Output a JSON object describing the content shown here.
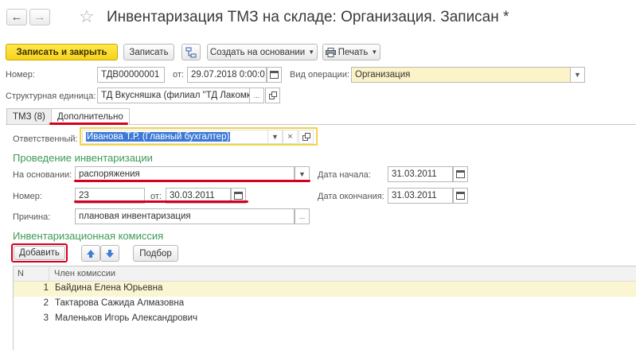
{
  "window": {
    "title": "Инвентаризация ТМЗ на складе: Организация. Записан *"
  },
  "toolbar": {
    "save_close_label": "Записать и закрыть",
    "save_label": "Записать",
    "create_based_label": "Создать на основании",
    "print_label": "Печать"
  },
  "header": {
    "number_label": "Номер:",
    "number_value": "ТДВ00000001",
    "from_label": "от:",
    "date_value": "29.07.2018  0:00:0",
    "operation_label": "Вид операции:",
    "operation_value": "Организация",
    "unit_label": "Структурная единица:",
    "unit_value": "ТД Вкусняшка (филиал \"ТД Лакомк"
  },
  "tabs": [
    {
      "label": "ТМЗ (8)"
    },
    {
      "label": "Дополнительно"
    }
  ],
  "details": {
    "responsible_label": "Ответственный:",
    "responsible_value": "Иванова Т.Р. (Главный бухгалтер)",
    "section_conduct": "Проведение инвентаризации",
    "basis_label": "На основании:",
    "basis_value": "распоряжения",
    "start_label": "Дата начала:",
    "start_value": "31.03.2011",
    "num_label": "Номер:",
    "num_value": "23",
    "from_label": "от:",
    "from_value": "30.03.2011",
    "end_label": "Дата окончания:",
    "end_value": "31.03.2011",
    "reason_label": "Причина:",
    "reason_value": "плановая инвентаризация",
    "section_commission": "Инвентаризационная комиссия",
    "add_label": "Добавить",
    "pick_label": "Подбор"
  },
  "table": {
    "columns": [
      "N",
      "Член комиссии"
    ],
    "rows": [
      {
        "n": "1",
        "member": "Байдина Елена Юрьевна"
      },
      {
        "n": "2",
        "member": "Тактарова Сажида Алмазовна"
      },
      {
        "n": "3",
        "member": "Маленьков Игорь Александрович"
      }
    ]
  },
  "colors": {
    "primary_button": "#f7d21b",
    "section_text": "#3d9a56",
    "highlight_red": "#d6001c",
    "selected_row": "#fbf6d2"
  },
  "icons": [
    "back-arrow-icon",
    "forward-arrow-icon",
    "star-icon",
    "structure-icon",
    "printer-icon",
    "calendar-icon",
    "open-icon",
    "arrow-up-icon",
    "arrow-down-icon"
  ]
}
